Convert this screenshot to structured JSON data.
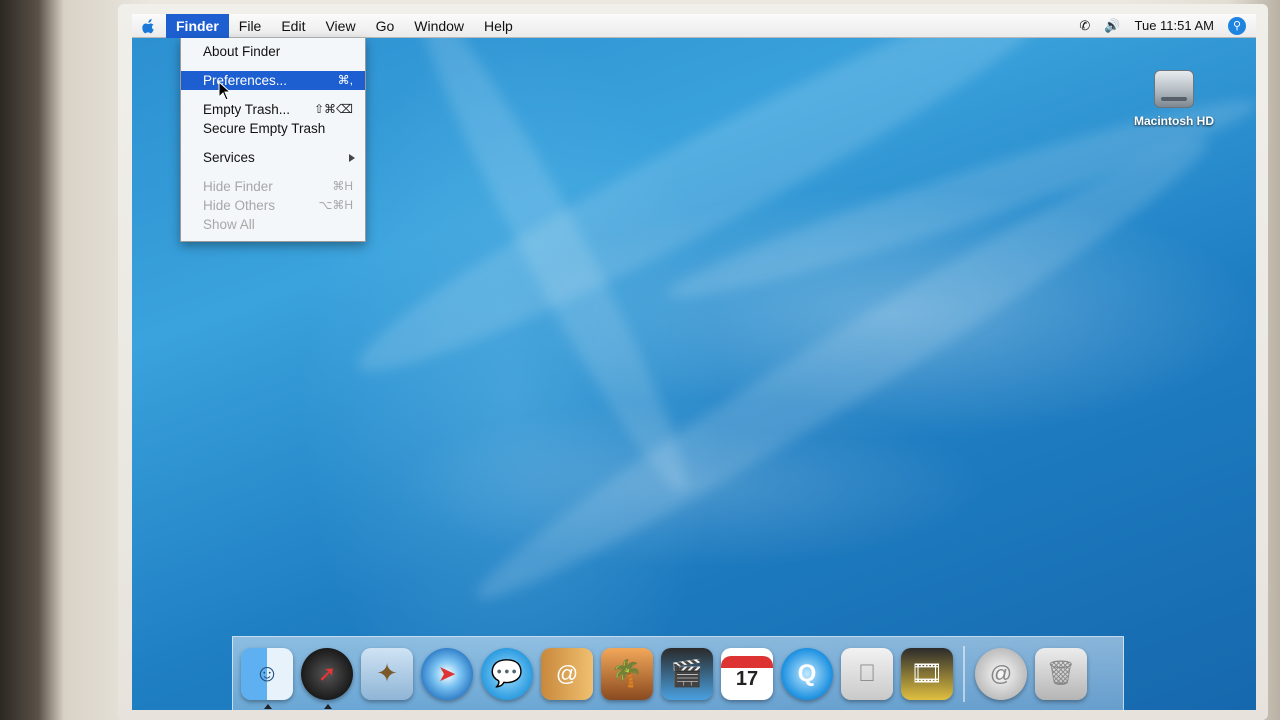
{
  "menubar": {
    "apple_icon": "apple-logo",
    "items": [
      "Finder",
      "File",
      "Edit",
      "View",
      "Go",
      "Window",
      "Help"
    ],
    "active_index": 0,
    "clock": "Tue 11:51 AM",
    "status_icons": [
      "phone-icon",
      "volume-icon",
      "spotlight-icon"
    ]
  },
  "finder_menu": {
    "items": [
      {
        "label": "About Finder",
        "shortcut": "",
        "state": "normal"
      },
      {
        "label": "Preferences...",
        "shortcut": "⌘,",
        "state": "highlighted"
      },
      {
        "label": "Empty Trash...",
        "shortcut": "⇧⌘⌫",
        "state": "normal"
      },
      {
        "label": "Secure Empty Trash",
        "shortcut": "",
        "state": "normal"
      },
      {
        "label": "Services",
        "shortcut": "",
        "state": "submenu"
      },
      {
        "label": "Hide Finder",
        "shortcut": "⌘H",
        "state": "disabled"
      },
      {
        "label": "Hide Others",
        "shortcut": "⌥⌘H",
        "state": "disabled"
      },
      {
        "label": "Show All",
        "shortcut": "",
        "state": "disabled"
      }
    ]
  },
  "desktop": {
    "hd_label": "Macintosh HD"
  },
  "dock": {
    "items": [
      {
        "name": "finder-icon",
        "running": true
      },
      {
        "name": "dashboard-icon",
        "running": true
      },
      {
        "name": "mail-icon",
        "running": false
      },
      {
        "name": "safari-icon",
        "running": false
      },
      {
        "name": "ichat-icon",
        "running": false
      },
      {
        "name": "address-book-icon",
        "running": false
      },
      {
        "name": "iphoto-icon",
        "running": false
      },
      {
        "name": "imovie-icon",
        "running": false
      },
      {
        "name": "ical-icon",
        "running": false,
        "text": "17"
      },
      {
        "name": "quicktime-icon",
        "running": false
      },
      {
        "name": "system-preferences-icon",
        "running": false
      },
      {
        "name": "idvd-icon",
        "running": false
      },
      {
        "name": "downloads-icon",
        "running": false
      },
      {
        "name": "trash-icon",
        "running": false
      }
    ]
  }
}
